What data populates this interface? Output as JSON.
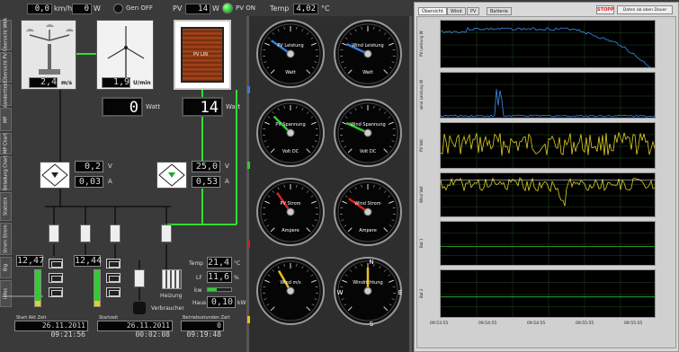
{
  "topbar": {
    "wind_speed_value": "0,0",
    "wind_speed_unit": "km/h",
    "gen_power_value": "0",
    "gen_power_unit": "W",
    "gen_status": "Gen OFF",
    "pv_label": "PV",
    "pv_power_value": "14",
    "pv_power_unit": "W",
    "pv_status": "PV ON",
    "temp_label": "Temp",
    "temp_value": "4,02",
    "temp_unit": "°C"
  },
  "sidebar_tabs": [
    "Übersicht WKA",
    "Übersicht PV",
    "Standorttest",
    "MP",
    "MP Chart",
    "Beladung Chart",
    "Statistik",
    "Strom Strom",
    "Big",
    "Infos"
  ],
  "turbine": {
    "anemometer_value": "2,4",
    "anemometer_unit": "m/s",
    "rotor_value": "1,9",
    "rotor_unit": "U/min",
    "pv_module_label": "PV LIN",
    "wind_watt_value": "0",
    "wind_watt_unit": "Watt",
    "pv_watt_value": "14",
    "pv_watt_unit": "Watt"
  },
  "converters": {
    "wind_v_value": "0,2",
    "wind_a_value": "0,03",
    "pv_v_value": "25,0",
    "pv_a_value": "0,53",
    "v_unit": "V",
    "a_unit": "A"
  },
  "batteries": {
    "bank1_value": "12,47",
    "bank2_value": "12,44",
    "bank_unit": "V"
  },
  "environment": {
    "temp_label": "Temp",
    "temp_value": "21,4",
    "temp_unit": "°C",
    "lf_label": "LF",
    "lf_value": "11,6",
    "lf_unit": "%",
    "kw_label": "kw",
    "haus_label": "Haus",
    "haus_value": "0,10",
    "haus_unit": "kW",
    "heizung_label": "Heizung",
    "verbraucher_label": "Verbraucher"
  },
  "footer": {
    "start_label": "Start Akt Zeit",
    "start_value": "26.11.2011  09:21:56",
    "startzeit_label": "Startzeit",
    "startzeit_value": "26.11.2011  00:02:08",
    "betrieb_label": "Betriebsstunden Zeit",
    "betrieb_value": "0  09:19:48"
  },
  "gauges": [
    {
      "title": "PV Leistung",
      "unit": "Watt",
      "needle_deg": 215,
      "needle_color": "#3a7bd5"
    },
    {
      "title": "Wind Leistung",
      "unit": "Watt",
      "needle_deg": 205,
      "needle_color": "#3a7bd5"
    },
    {
      "title": "PV Spannung",
      "unit": "Volt DC",
      "needle_deg": 225,
      "needle_color": "#33cc33"
    },
    {
      "title": "Wind Spannung",
      "unit": "Volt DC",
      "needle_deg": 205,
      "needle_color": "#33cc33"
    },
    {
      "title": "PV Strom",
      "unit": "Ampere",
      "needle_deg": 235,
      "needle_color": "#e02020"
    },
    {
      "title": "Wind Strom",
      "unit": "Ampere",
      "needle_deg": 215,
      "needle_color": "#e02020"
    },
    {
      "title": "Wind m/s",
      "unit": "",
      "needle_deg": 240,
      "needle_color": "#e8c020"
    },
    {
      "title": "Windrichtung",
      "unit": "",
      "needle_deg": 270,
      "needle_color": "#e8c020"
    }
  ],
  "compass": {
    "n": "N",
    "s": "S",
    "w": "W",
    "e": "E"
  },
  "chart_panel": {
    "tabs": [
      "Übersicht",
      "Wind",
      "PV",
      "Batterie"
    ],
    "stop_label": "STOPP",
    "save_label": "Daten ab oben Dauer",
    "x_ticks": [
      "09:53:55",
      "09:54:55",
      "09:54:55",
      "09:55:55",
      "09:55:55"
    ],
    "y_labels": [
      "PV Leistung W",
      "wind Leistung W",
      "PV Volt",
      "Wind Volt",
      "Bat 1",
      "Bat 2"
    ]
  },
  "colors": {
    "green_accent": "#33dd33",
    "chart_line_blue": "#3a8ef0",
    "chart_line_yellow": "#e0d020",
    "chart_line_green": "#30c030"
  }
}
